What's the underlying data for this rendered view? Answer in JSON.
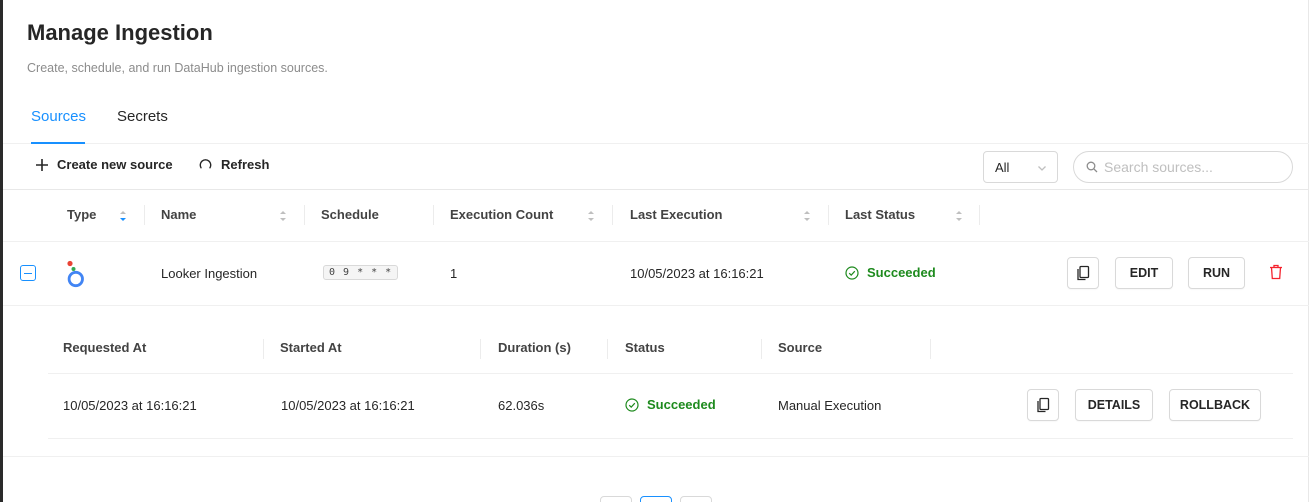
{
  "page": {
    "title": "Manage Ingestion",
    "subtitle": "Create, schedule, and run DataHub ingestion sources."
  },
  "tabs": [
    {
      "label": "Sources",
      "active": true
    },
    {
      "label": "Secrets",
      "active": false
    }
  ],
  "toolbar": {
    "create_label": "Create new source",
    "create_icon": "plus-icon",
    "refresh_label": "Refresh",
    "refresh_icon": "refresh-icon",
    "filter_value": "All",
    "search_placeholder": "Search sources..."
  },
  "table": {
    "columns": [
      "Type",
      "Name",
      "Schedule",
      "Execution Count",
      "Last Execution",
      "Last Status"
    ],
    "rows": [
      {
        "type_icon": "looker-logo-icon",
        "name": "Looker Ingestion",
        "schedule": "0 9 * * *",
        "execution_count": "1",
        "last_execution": "10/05/2023 at 16:16:21",
        "last_status": "Succeeded",
        "actions": {
          "copy_icon": "copy-icon",
          "edit_label": "EDIT",
          "run_label": "RUN",
          "delete_icon": "delete-icon"
        }
      }
    ]
  },
  "executions": {
    "columns": [
      "Requested At",
      "Started At",
      "Duration (s)",
      "Status",
      "Source"
    ],
    "rows": [
      {
        "requested_at": "10/05/2023 at 16:16:21",
        "started_at": "10/05/2023 at 16:16:21",
        "duration": "62.036s",
        "status": "Succeeded",
        "source": "Manual Execution",
        "details_label": "DETAILS",
        "rollback_label": "ROLLBACK"
      }
    ]
  },
  "colors": {
    "accent": "#1890ff",
    "success": "#1d8a1d",
    "danger": "#f5222d"
  }
}
